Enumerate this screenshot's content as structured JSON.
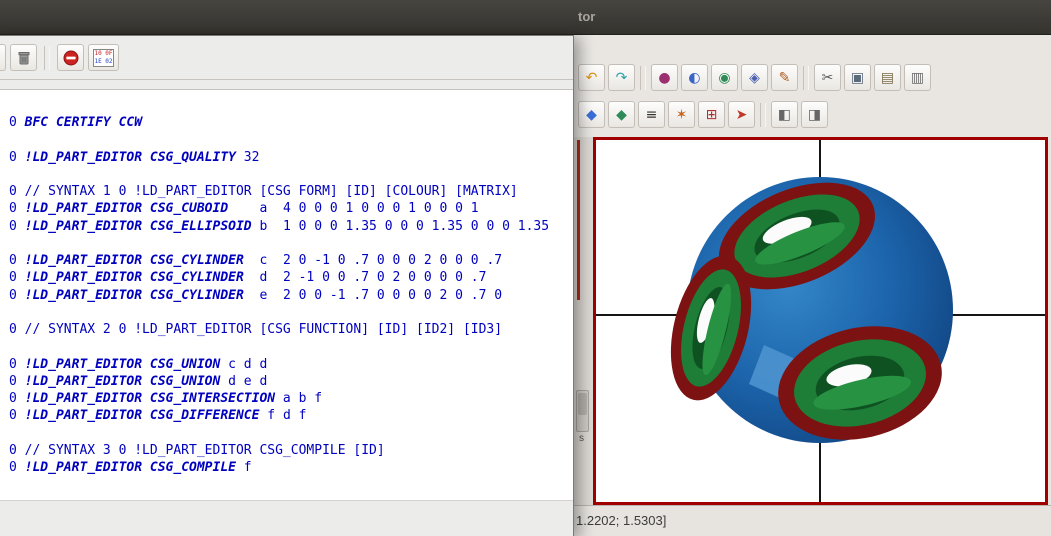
{
  "colors": {
    "titlebar": "#3b3935",
    "toolbar_bg": "#e9e6e2",
    "viewport_border": "#a00000",
    "code_text": "#0000bf",
    "model_blue": "#1c64ab",
    "model_green": "#1e7d36",
    "model_green_dark": "#0f5222",
    "model_green_light": "#279342",
    "model_red": "#7c1212"
  },
  "window": {
    "title_fragment": "tor",
    "status_text": "1.2202; 1.5303]",
    "side_strip_label": "s"
  },
  "main_toolbar": {
    "row1": [
      {
        "name": "undo-button",
        "icon": "undo-icon",
        "glyph": "↶",
        "color": "#d9930d"
      },
      {
        "name": "redo-button",
        "icon": "redo-icon",
        "glyph": "↷",
        "color": "#2fa0a8"
      },
      {
        "sep": true
      },
      {
        "name": "sphere-tool-button",
        "icon": "sphere-icon",
        "glyph": "●",
        "color": "#9c2f6e"
      },
      {
        "name": "cylinder-tool-button",
        "icon": "cylinder-icon",
        "glyph": "◐",
        "color": "#3a64c8"
      },
      {
        "name": "globe-tool-button",
        "icon": "globe-icon",
        "glyph": "◉",
        "color": "#2e8b57"
      },
      {
        "name": "prism-tool-button",
        "icon": "prism-icon",
        "glyph": "◈",
        "color": "#4b5fae"
      },
      {
        "name": "brush-tool-button",
        "icon": "brush-icon",
        "glyph": "✎",
        "color": "#b05a20"
      },
      {
        "sep": true
      },
      {
        "name": "cut-button",
        "icon": "scissors-icon",
        "glyph": "✂",
        "color": "#5a5a5a"
      },
      {
        "name": "copy-button",
        "icon": "copy-icon",
        "glyph": "▣",
        "color": "#5a6a7a"
      },
      {
        "name": "paste-button",
        "icon": "clipboard-icon",
        "glyph": "▤",
        "color": "#7a6a4a"
      },
      {
        "name": "delete-button",
        "icon": "trash-icon",
        "glyph": "▥",
        "color": "#6a6a6a"
      }
    ],
    "row2": [
      {
        "name": "shield-blue-button",
        "icon": "shield-icon",
        "glyph": "◆",
        "color": "#3a6fd8"
      },
      {
        "name": "shield-green-button",
        "icon": "shield-alt-icon",
        "glyph": "◆",
        "color": "#2e8b57"
      },
      {
        "name": "text-lines-button",
        "icon": "lines-icon",
        "glyph": "≡",
        "color": "#333333"
      },
      {
        "name": "orange-brush-button",
        "icon": "orange-brush-icon",
        "glyph": "✶",
        "color": "#c8651b"
      },
      {
        "name": "grid-button",
        "icon": "grid-icon",
        "glyph": "⊞",
        "color": "#b03030"
      },
      {
        "name": "pointer-button",
        "icon": "pointer-icon",
        "glyph": "➤",
        "color": "#c03a2b"
      },
      {
        "sep": true
      },
      {
        "name": "window-split-button",
        "icon": "window-split-icon",
        "glyph": "◧",
        "color": "#666666"
      },
      {
        "name": "window-merge-button",
        "icon": "window-merge-icon",
        "glyph": "◨",
        "color": "#666666"
      }
    ]
  },
  "editor": {
    "toolbar": {
      "hex_icon_top": "10 0F",
      "hex_icon_bottom": "1E 02"
    },
    "lines": [
      [
        {
          "t": "0 "
        },
        {
          "t": "BFC CERTIFY CCW",
          "b": true
        }
      ],
      [],
      [
        {
          "t": "0 "
        },
        {
          "t": "!LD_PART_EDITOR CSG_QUALITY",
          "b": true
        },
        {
          "t": " 32"
        }
      ],
      [],
      [
        {
          "t": "0 // SYNTAX 1 0 !LD_PART_EDITOR [CSG FORM] [ID] [COLOUR] [MATRIX]"
        }
      ],
      [
        {
          "t": "0 "
        },
        {
          "t": "!LD_PART_EDITOR CSG_CUBOID",
          "b": true
        },
        {
          "t": "    a  4 0 0 0 1 0 0 0 1 0 0 0 1"
        }
      ],
      [
        {
          "t": "0 "
        },
        {
          "t": "!LD_PART_EDITOR CSG_ELLIPSOID",
          "b": true
        },
        {
          "t": " b  1 0 0 0 1.35 0 0 0 1.35 0 0 0 1.35"
        }
      ],
      [],
      [
        {
          "t": "0 "
        },
        {
          "t": "!LD_PART_EDITOR CSG_CYLINDER",
          "b": true
        },
        {
          "t": "  c  2 0 -1 0 .7 0 0 0 2 0 0 0 .7"
        }
      ],
      [
        {
          "t": "0 "
        },
        {
          "t": "!LD_PART_EDITOR CSG_CYLINDER",
          "b": true
        },
        {
          "t": "  d  2 -1 0 0 .7 0 2 0 0 0 0 .7"
        }
      ],
      [
        {
          "t": "0 "
        },
        {
          "t": "!LD_PART_EDITOR CSG_CYLINDER",
          "b": true
        },
        {
          "t": "  e  2 0 0 -1 .7 0 0 0 0 2 0 .7 0"
        }
      ],
      [],
      [
        {
          "t": "0 // SYNTAX 2 0 !LD_PART_EDITOR [CSG FUNCTION] [ID] [ID2] [ID3]"
        }
      ],
      [],
      [
        {
          "t": "0 "
        },
        {
          "t": "!LD_PART_EDITOR CSG_UNION",
          "b": true
        },
        {
          "t": " c d d"
        }
      ],
      [
        {
          "t": "0 "
        },
        {
          "t": "!LD_PART_EDITOR CSG_UNION",
          "b": true
        },
        {
          "t": " d e d"
        }
      ],
      [
        {
          "t": "0 "
        },
        {
          "t": "!LD_PART_EDITOR CSG_INTERSECTION",
          "b": true
        },
        {
          "t": " a b f"
        }
      ],
      [
        {
          "t": "0 "
        },
        {
          "t": "!LD_PART_EDITOR CSG_DIFFERENCE",
          "b": true
        },
        {
          "t": " f d f"
        }
      ],
      [],
      [
        {
          "t": "0 // SYNTAX 3 0 !LD_PART_EDITOR CSG_COMPILE [ID]"
        }
      ],
      [
        {
          "t": "0 "
        },
        {
          "t": "!LD_PART_EDITOR CSG_COMPILE",
          "b": true
        },
        {
          "t": " f"
        }
      ]
    ]
  }
}
